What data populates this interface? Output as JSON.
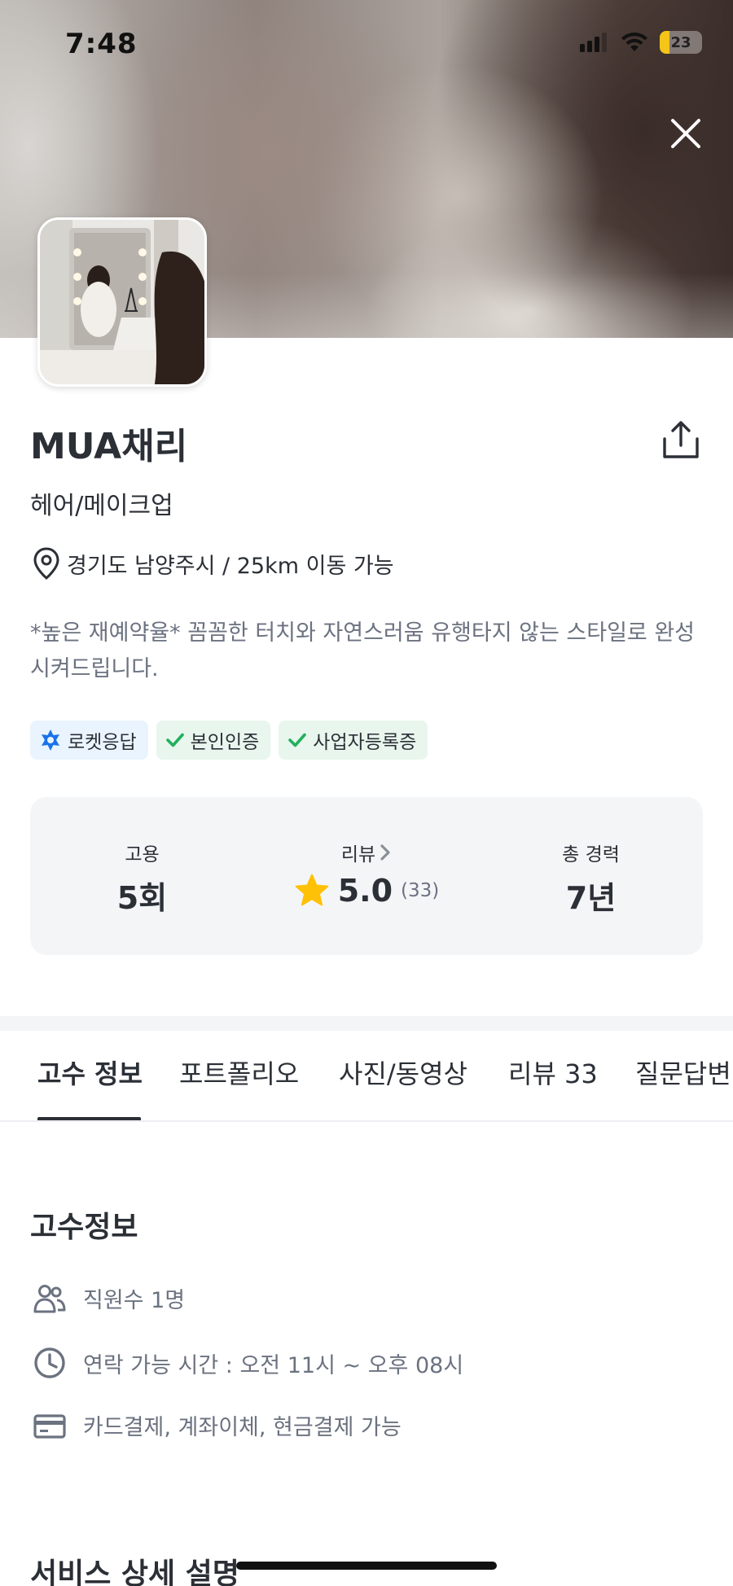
{
  "status_bar": {
    "time": "7:48",
    "battery": "23",
    "battery_level": 0.23
  },
  "icons": {
    "close": "close-icon",
    "share": "share-icon",
    "location": "map-pin-icon",
    "rocket": "rocket-icon",
    "check": "check-icon",
    "star": "star-icon",
    "people": "people-icon",
    "clock": "clock-icon",
    "card": "card-icon",
    "chevron": "chevron-right-icon"
  },
  "colors": {
    "accent_blue": "#1a73e8",
    "check_green": "#22b05b",
    "star_yellow": "#ffc107",
    "text_dark": "#2b2f36",
    "text_gray": "#6b7280"
  },
  "profile": {
    "name": "MUA채리",
    "category": "헤어/메이크업",
    "location": "경기도 남양주시 / 25km 이동 가능",
    "intro": "*높은 재예약율* 꼼꼼한 터치와 자연스러움 유행타지 않는 스타일로 완성시켜드립니다."
  },
  "badges": [
    {
      "label": "로켓응답",
      "type": "rocket"
    },
    {
      "label": "본인인증",
      "type": "check"
    },
    {
      "label": "사업자등록증",
      "type": "check"
    }
  ],
  "stats": {
    "hire": {
      "label": "고용",
      "value": "5회"
    },
    "review": {
      "label": "리뷰",
      "value": "5.0",
      "count": "(33)"
    },
    "career": {
      "label": "총 경력",
      "value": "7년"
    }
  },
  "tabs": [
    "고수 정보",
    "포트폴리오",
    "사진/동영상",
    "리뷰 33",
    "질문답변"
  ],
  "info": {
    "title": "고수정보",
    "employees": "직원수 1명",
    "hours": "연락 가능 시간 : 오전 11시  ~ 오후 08시",
    "payment": "카드결제, 계좌이체, 현금결제 가능"
  },
  "service": {
    "title": "서비스 상세 설명"
  }
}
